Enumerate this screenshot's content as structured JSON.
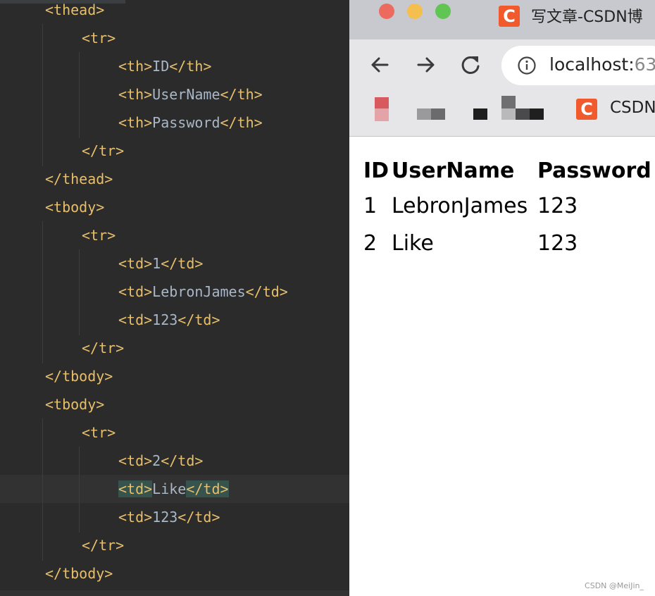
{
  "editor": {
    "lines": [
      {
        "parts": [
          [
            "tag",
            "<thead>"
          ]
        ]
      },
      {
        "parts": [
          [
            "tag",
            "<tr>"
          ]
        ]
      },
      {
        "parts": [
          [
            "tag",
            "<th>"
          ],
          [
            "txt",
            "ID"
          ],
          [
            "tag",
            "</th>"
          ]
        ]
      },
      {
        "parts": [
          [
            "tag",
            "<th>"
          ],
          [
            "txt",
            "UserName"
          ],
          [
            "tag",
            "</th>"
          ]
        ]
      },
      {
        "parts": [
          [
            "tag",
            "<th>"
          ],
          [
            "txt",
            "Password"
          ],
          [
            "tag",
            "</th>"
          ]
        ]
      },
      {
        "parts": [
          [
            "tag",
            "</tr>"
          ]
        ]
      },
      {
        "parts": [
          [
            "tag",
            "</thead>"
          ]
        ]
      },
      {
        "parts": [
          [
            "tag",
            "<tbody>"
          ]
        ]
      },
      {
        "parts": [
          [
            "tag",
            "<tr>"
          ]
        ]
      },
      {
        "parts": [
          [
            "tag",
            "<td>"
          ],
          [
            "txt",
            "1"
          ],
          [
            "tag",
            "</td>"
          ]
        ]
      },
      {
        "parts": [
          [
            "tag",
            "<td>"
          ],
          [
            "txt",
            "LebronJames"
          ],
          [
            "tag",
            "</td>"
          ]
        ]
      },
      {
        "parts": [
          [
            "tag",
            "<td>"
          ],
          [
            "txt",
            "123"
          ],
          [
            "tag",
            "</td>"
          ]
        ]
      },
      {
        "parts": [
          [
            "tag",
            "</tr>"
          ]
        ]
      },
      {
        "parts": [
          [
            "tag",
            "</tbody>"
          ]
        ]
      },
      {
        "parts": [
          [
            "tag",
            "<tbody>"
          ]
        ]
      },
      {
        "parts": [
          [
            "tag",
            "<tr>"
          ]
        ]
      },
      {
        "parts": [
          [
            "tag",
            "<td>"
          ],
          [
            "txt",
            "2"
          ],
          [
            "tag",
            "</td>"
          ]
        ]
      },
      {
        "parts": [
          [
            "tag",
            "<td>"
          ],
          [
            "txt",
            "Like"
          ],
          [
            "tag",
            "</td>"
          ]
        ],
        "highlight": true
      },
      {
        "parts": [
          [
            "tag",
            "<td>"
          ],
          [
            "txt",
            "123"
          ],
          [
            "tag",
            "</td>"
          ]
        ]
      },
      {
        "parts": [
          [
            "tag",
            "</tr>"
          ]
        ]
      },
      {
        "parts": [
          [
            "tag",
            "</tbody>"
          ]
        ]
      }
    ],
    "colors": {
      "tag": "#e8bf6a",
      "text": "#a9b7c6",
      "background": "#2b2b2b"
    }
  },
  "browser": {
    "tab_title": "写文章-CSDN博",
    "tab_favicon": "C",
    "address": "localhost:",
    "address_tail": "63",
    "bookmark_csdn": "CSDN",
    "bookmark_csdn_favicon": "C",
    "icons": {
      "back": "back-arrow-icon",
      "forward": "forward-arrow-icon",
      "reload": "reload-icon",
      "info": "info-icon"
    }
  },
  "page": {
    "table": {
      "headers": [
        "ID",
        "UserName",
        "Password"
      ],
      "rows": [
        [
          "1",
          "LebronJames",
          "123"
        ],
        [
          "2",
          "Like",
          "123"
        ]
      ]
    }
  },
  "watermark": "CSDN @MeiJin_"
}
